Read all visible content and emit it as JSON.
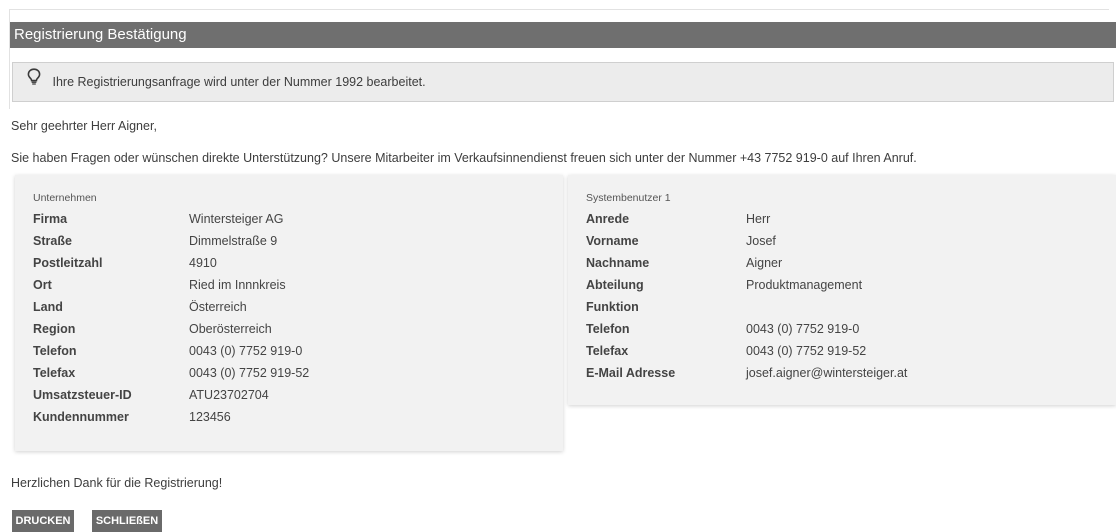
{
  "window": {
    "title": "Registrierung Bestätigung"
  },
  "notice": {
    "icon": "lightbulb-icon",
    "text": "Ihre Registrierungsanfrage wird unter der Nummer 1992 bearbeitet."
  },
  "salutation": "Sehr geehrter Herr Aigner,",
  "support_text": "Sie haben Fragen oder wünschen direkte Unterstützung? Unsere Mitarbeiter im Verkaufsinnendienst freuen sich unter der Nummer +43 7752 919-0 auf Ihren Anruf.",
  "company": {
    "heading": "Unternehmen",
    "rows": [
      {
        "label": "Firma",
        "value": "Wintersteiger AG"
      },
      {
        "label": "Straße",
        "value": "Dimmelstraße 9"
      },
      {
        "label": "Postleitzahl",
        "value": "4910"
      },
      {
        "label": "Ort",
        "value": "Ried im Innnkreis"
      },
      {
        "label": "Land",
        "value": "Österreich"
      },
      {
        "label": "Region",
        "value": "Oberösterreich"
      },
      {
        "label": "Telefon",
        "value": "0043 (0) 7752 919-0"
      },
      {
        "label": "Telefax",
        "value": "0043 (0) 7752 919-52"
      },
      {
        "label": "Umsatzsteuer-ID",
        "value": "ATU23702704"
      },
      {
        "label": "Kundennummer",
        "value": "123456"
      }
    ]
  },
  "user": {
    "heading": "Systembenutzer 1",
    "rows": [
      {
        "label": "Anrede",
        "value": "Herr"
      },
      {
        "label": "Vorname",
        "value": "Josef"
      },
      {
        "label": "Nachname",
        "value": "Aigner"
      },
      {
        "label": "Abteilung",
        "value": "Produktmanagement"
      },
      {
        "label": "Funktion",
        "value": ""
      },
      {
        "label": "Telefon",
        "value": "0043 (0) 7752 919-0"
      },
      {
        "label": "Telefax",
        "value": "0043 (0) 7752 919-52"
      },
      {
        "label": "E-Mail Adresse",
        "value": "josef.aigner@wintersteiger.at"
      }
    ]
  },
  "thanks": "Herzlichen Dank für die Registrierung!",
  "buttons": {
    "print": "DRUCKEN",
    "close": "SCHLIEßEN"
  },
  "colors": {
    "titlebar": "#6f6f6f",
    "button": "#6a6a6a",
    "card": "#f2f2f2",
    "notice": "#ececec"
  }
}
